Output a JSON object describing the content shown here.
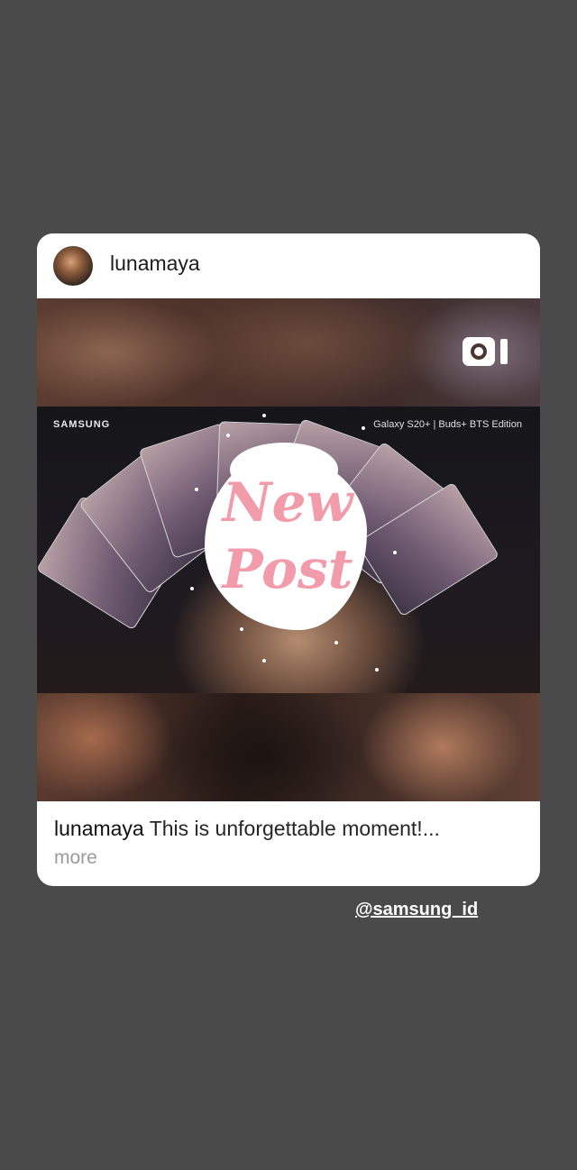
{
  "post": {
    "username": "lunamaya",
    "caption_user": "lunamaya",
    "caption_text": "This is unforgettable moment!...",
    "more_label": "more",
    "video": {
      "brand": "SAMSUNG",
      "edition": "Galaxy S20+ | Buds+ BTS Edition",
      "overlay_line1": "New",
      "overlay_line2": "Post"
    }
  },
  "mention": "@samsung_id",
  "icons": {
    "reels": "reels-icon",
    "avatar": "avatar"
  },
  "colors": {
    "background": "#4a4a4a",
    "card": "#ffffff",
    "overlay_text": "#f19bab"
  }
}
